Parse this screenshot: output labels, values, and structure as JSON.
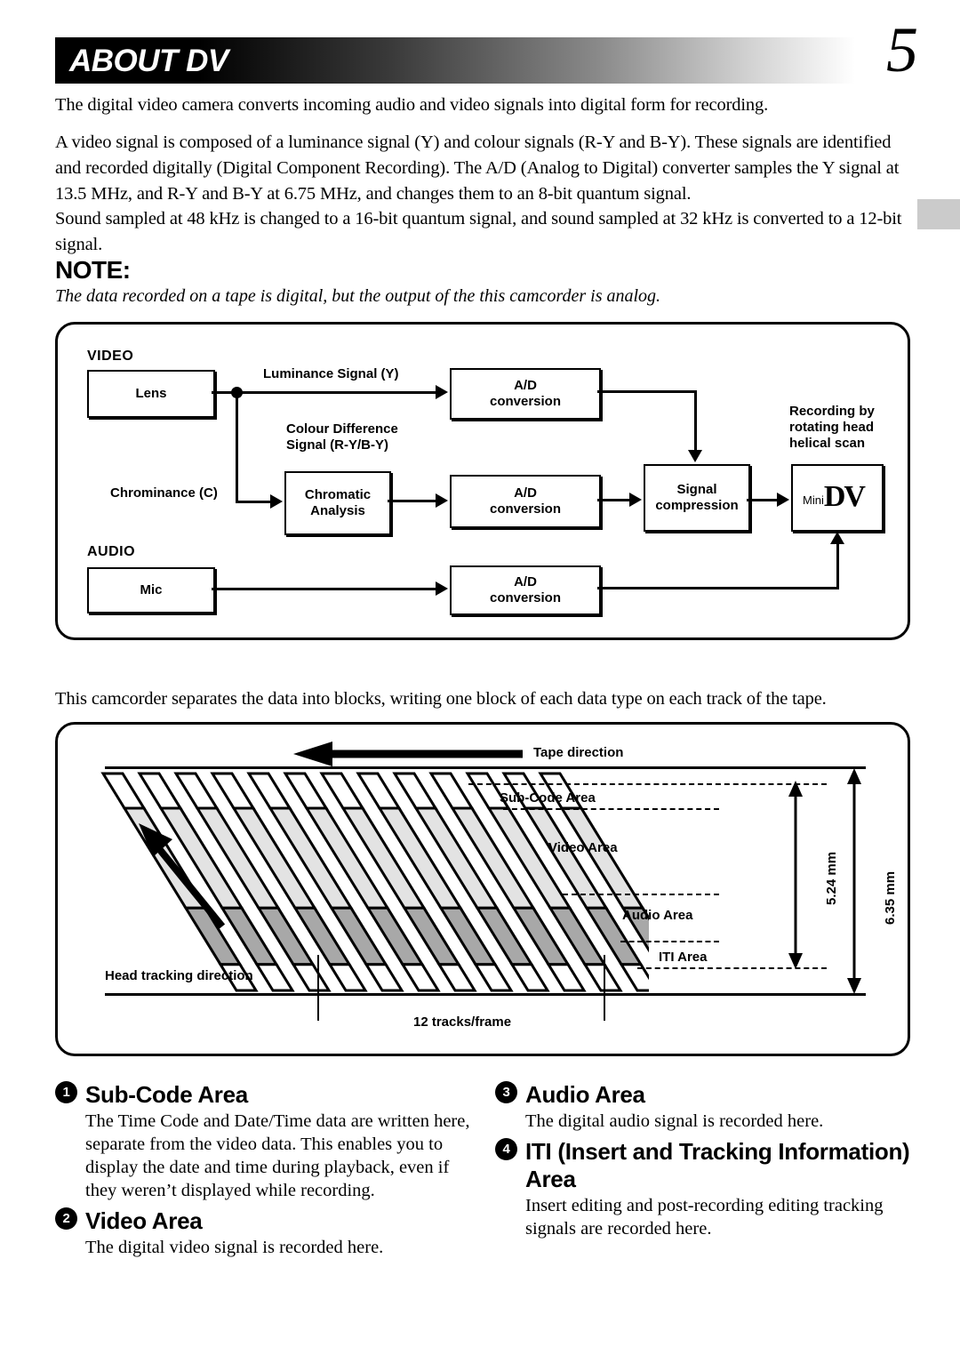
{
  "header": {
    "title": "ABOUT DV",
    "page_number": "5"
  },
  "body": {
    "para_1": "The digital video camera converts incoming audio and video signals into digital form for recording.",
    "para_2": "A video signal is composed of a luminance signal (Y) and colour signals (R-Y and B-Y). These signals are identified and recorded digitally (Digital Component Recording). The A/D (Analog to Digital) converter samples the Y signal at 13.5 MHz, and R-Y and B-Y at 6.75 MHz, and changes them to an 8-bit quantum signal.",
    "para_3": "Sound sampled at 48 kHz is changed to a 16-bit quantum signal, and sound sampled at 32 kHz is converted to a 12-bit signal.",
    "note_heading": "NOTE:",
    "note_text": "The data recorded on a tape is digital, but the output of the this camcorder is analog.",
    "para_4": "This camcorder separates the data into blocks, writing one block of each data type on each track of the tape."
  },
  "block_diagram": {
    "section_video": "VIDEO",
    "section_audio": "AUDIO",
    "box_lens": "Lens",
    "box_chromatic": "Chromatic\nAnalysis",
    "box_mic": "Mic",
    "box_ad_1": "A/D\nconversion",
    "box_ad_2": "A/D\nconversion",
    "box_ad_3": "A/D\nconversion",
    "box_compression": "Signal\ncompression",
    "label_luminance": "Luminance Signal (Y)",
    "label_colour_difference": "Colour Difference\nSignal (R-Y/B-Y)",
    "label_chrominance": "Chrominance (C)",
    "label_recording": "Recording by\nrotating head\nhelical scan",
    "minidv_mini": "Mini",
    "minidv_dv": "DV"
  },
  "tape_diagram": {
    "tape_direction": "Tape direction",
    "head_tracking": "Head tracking direction",
    "tracks_per_frame": "12 tracks/frame",
    "area_subcode": "Sub-Code Area",
    "area_video": "Video Area",
    "area_audio": "Audio Area",
    "area_iti": "ITI Area",
    "dim_inner": "5.24 mm",
    "dim_outer": "6.35 mm",
    "track_count": 13,
    "colors": {
      "subcode_fill": "#ffffff",
      "video_fill": "#e3e3e3",
      "audio_fill": "#a8a8a8",
      "iti_fill": "#ffffff",
      "stroke": "#000000"
    }
  },
  "sections": [
    {
      "number": "1",
      "title": "Sub-Code Area",
      "text": "The Time Code and Date/Time data are written here, separate from the video data. This enables you to display the date and time during playback, even if they weren’t displayed while recording."
    },
    {
      "number": "2",
      "title": "Video Area",
      "text": "The digital video signal is recorded here."
    },
    {
      "number": "3",
      "title": "Audio Area",
      "text": "The digital audio signal is recorded here."
    },
    {
      "number": "4",
      "title": "ITI (Insert and Tracking Information) Area",
      "text": "Insert editing and post-recording editing tracking signals are recorded here."
    }
  ]
}
